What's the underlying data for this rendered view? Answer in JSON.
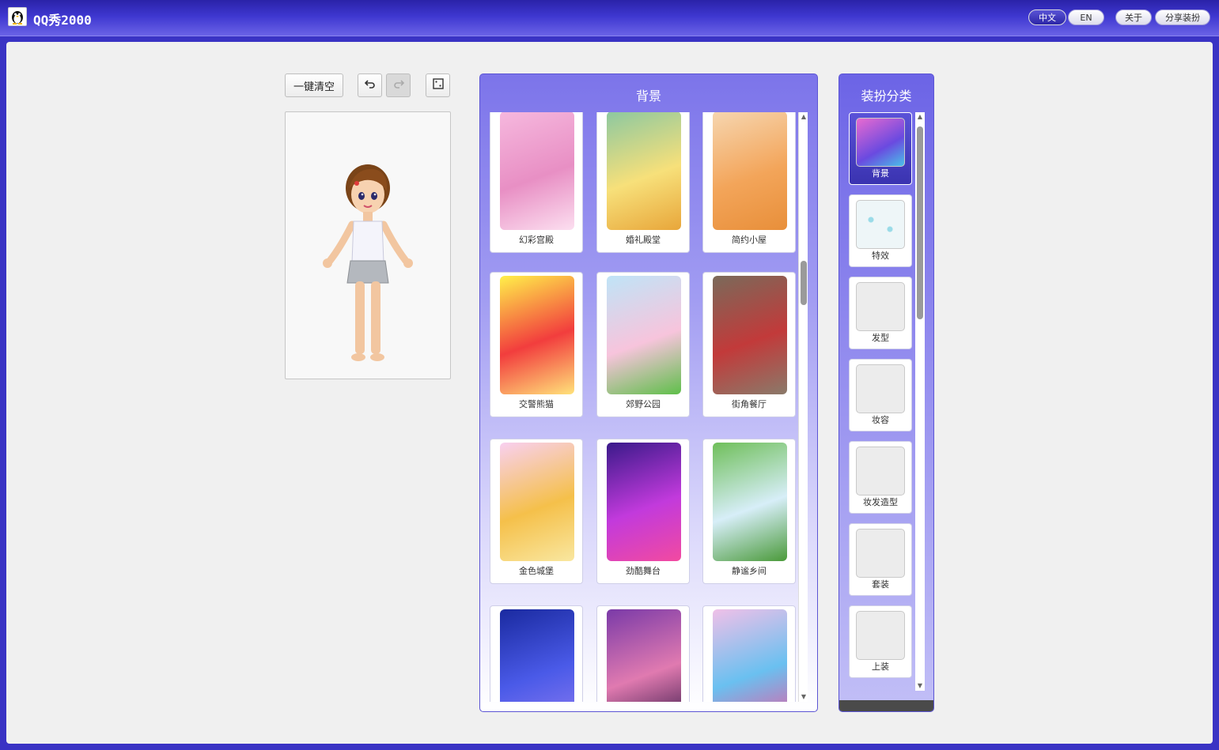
{
  "app": {
    "title": "QQ秀2000",
    "logo_icon": "penguin-icon"
  },
  "topbar": {
    "lang_zh": "中文",
    "lang_en": "EN",
    "about": "关于",
    "share": "分享装扮"
  },
  "toolbar": {
    "clear_label": "一键清空",
    "undo_icon": "undo-icon",
    "redo_icon": "redo-icon",
    "random_icon": "dice-icon"
  },
  "background_panel": {
    "title": "背景",
    "items": [
      {
        "label": "幻彩宫殿",
        "colors": [
          "#f6b8de",
          "#e88fc4",
          "#fcdff0"
        ]
      },
      {
        "label": "婚礼殿堂",
        "colors": [
          "#8cc8a0",
          "#f7e07a",
          "#e8a63a"
        ]
      },
      {
        "label": "简约小屋",
        "colors": [
          "#f6d6b0",
          "#f3a55a",
          "#e88f3a"
        ]
      },
      {
        "label": "交警熊猫",
        "colors": [
          "#fff04a",
          "#f23d3d",
          "#ffe27a"
        ]
      },
      {
        "label": "郊野公园",
        "colors": [
          "#bfe4f7",
          "#f7c4dc",
          "#5fbf4a"
        ]
      },
      {
        "label": "街角餐厅",
        "colors": [
          "#7a6a5a",
          "#c23a3a",
          "#8a7a6a"
        ]
      },
      {
        "label": "金色城堡",
        "colors": [
          "#f8d0f0",
          "#f5c04a",
          "#f9e7a0"
        ]
      },
      {
        "label": "劲酷舞台",
        "colors": [
          "#3a1a8a",
          "#c23adc",
          "#f24aa0"
        ]
      },
      {
        "label": "静谧乡间",
        "colors": [
          "#6fbf5a",
          "#d7eef8",
          "#4a9a3a"
        ]
      },
      {
        "label": "",
        "colors": [
          "#1a2aa0",
          "#4a5ae8",
          "#8a7af0"
        ]
      },
      {
        "label": "",
        "colors": [
          "#7a3aa8",
          "#e07ab0",
          "#3a1a4a"
        ]
      },
      {
        "label": "",
        "colors": [
          "#f0c0e8",
          "#6ac0f0",
          "#e85aa0"
        ]
      }
    ]
  },
  "category_panel": {
    "title": "装扮分类",
    "items": [
      {
        "label": "背景",
        "icon": "background-icon",
        "selected": true
      },
      {
        "label": "特效",
        "icon": "sparkle-icon",
        "selected": false
      },
      {
        "label": "发型",
        "icon": "hair-icon",
        "selected": false
      },
      {
        "label": "妆容",
        "icon": "face-icon",
        "selected": false
      },
      {
        "label": "妆发造型",
        "icon": "hat-icon",
        "selected": false
      },
      {
        "label": "套装",
        "icon": "outfit-icon",
        "selected": false
      },
      {
        "label": "上装",
        "icon": "top-icon",
        "selected": false
      }
    ]
  }
}
